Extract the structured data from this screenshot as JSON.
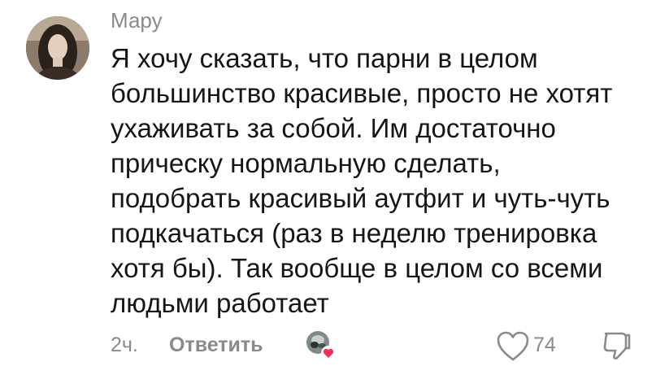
{
  "comment": {
    "author": "Мару",
    "text_lines": [
      "Я хочу сказать, что парни в целом",
      "большинство красивые, просто не хотят",
      "ухаживать за собой. Им достаточно",
      "прическу нормальную сделать,",
      "подобрать красивый аутфит и чуть-чуть",
      "подкачаться (раз в неделю тренировка",
      "хотя бы). Так вообще в целом со всеми",
      "людьми работает"
    ],
    "time": "2ч.",
    "reply_label": "Ответить",
    "like_count": "74"
  },
  "icons": {
    "like": "heart-outline-icon",
    "dislike": "thumbs-down-icon",
    "liked_by_author": "heart-badge-icon"
  },
  "colors": {
    "secondary_text": "#8a8a8a",
    "primary_text": "#161616",
    "heart_badge": "#fe2c55"
  }
}
